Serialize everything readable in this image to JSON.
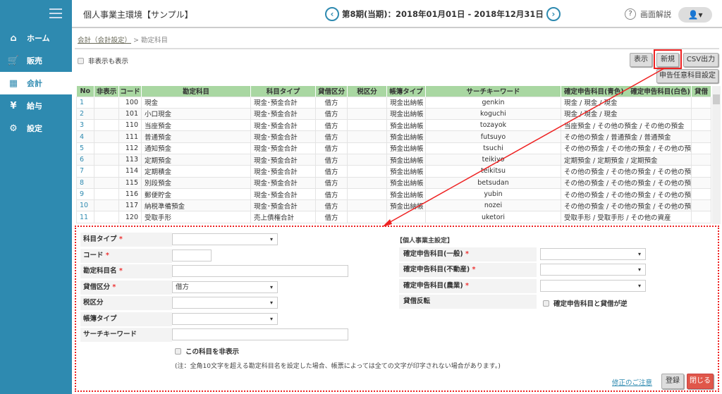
{
  "sidebar": {
    "items": [
      {
        "label": "ホーム",
        "icon": "home-icon"
      },
      {
        "label": "販売",
        "icon": "cart-icon"
      },
      {
        "label": "会計",
        "icon": "calculator-icon",
        "active": true
      },
      {
        "label": "給与",
        "icon": "money-bag-icon"
      },
      {
        "label": "設定",
        "icon": "gear-icon"
      }
    ]
  },
  "header": {
    "title": "個人事業主環境【サンプル】",
    "period": "第8期(当期)：2018年01月01日 - 2018年12月31日",
    "prev": "‹",
    "next": "›",
    "help": "画面解説",
    "help_icon": "?"
  },
  "breadcrumb": {
    "parent": "会計（会計設定）",
    "sep": ">",
    "current": "勘定科目"
  },
  "toolbar": {
    "show_hidden": "非表示も表示",
    "display": "表示",
    "new": "新規",
    "csv": "CSV出力",
    "custom": "申告任意科目設定"
  },
  "table": {
    "headers": [
      "No",
      "非表示",
      "コード",
      "勘定科目",
      "科目タイプ",
      "貸借区分",
      "税区分",
      "帳簿タイプ",
      "サーチキーワード",
      "確定申告科目(青色)",
      "確定申告科目(白色)",
      "貸借"
    ],
    "rows": [
      [
        "1",
        "",
        "100",
        "現金",
        "現金･預金合計",
        "借方",
        "",
        "現金出納帳",
        "genkin",
        "現金 / 現金 / 現金",
        ""
      ],
      [
        "2",
        "",
        "101",
        "小口現金",
        "現金･預金合計",
        "借方",
        "",
        "現金出納帳",
        "koguchi",
        "現金 / 現金 / 現金",
        ""
      ],
      [
        "3",
        "",
        "110",
        "当座預金",
        "現金･預金合計",
        "借方",
        "",
        "預金出納帳",
        "tozayok",
        "当座預金 / その他の預金 / その他の預金",
        ""
      ],
      [
        "4",
        "",
        "111",
        "普通預金",
        "現金･預金合計",
        "借方",
        "",
        "預金出納帳",
        "futsuyo",
        "その他の預金 / 普通預金 / 普通預金",
        ""
      ],
      [
        "5",
        "",
        "112",
        "通知預金",
        "現金･預金合計",
        "借方",
        "",
        "預金出納帳",
        "tsuchi",
        "その他の預金 / その他の預金 / その他の預金",
        ""
      ],
      [
        "6",
        "",
        "113",
        "定期預金",
        "現金･預金合計",
        "借方",
        "",
        "預金出納帳",
        "teikiyo",
        "定期預金 / 定期預金 / 定期預金",
        ""
      ],
      [
        "7",
        "",
        "114",
        "定期積金",
        "現金･預金合計",
        "借方",
        "",
        "預金出納帳",
        "teikitsu",
        "その他の預金 / その他の預金 / その他の預金",
        ""
      ],
      [
        "8",
        "",
        "115",
        "別段預金",
        "現金･預金合計",
        "借方",
        "",
        "預金出納帳",
        "betsudan",
        "その他の預金 / その他の預金 / その他の預金",
        ""
      ],
      [
        "9",
        "",
        "116",
        "郵便貯金",
        "現金･預金合計",
        "借方",
        "",
        "預金出納帳",
        "yubin",
        "その他の預金 / その他の預金 / その他の預金",
        ""
      ],
      [
        "10",
        "",
        "117",
        "納税準備預金",
        "現金･預金合計",
        "借方",
        "",
        "預金出納帳",
        "nozei",
        "その他の預金 / その他の預金 / その他の預金",
        ""
      ],
      [
        "11",
        "",
        "120",
        "受取手形",
        "売上債権合計",
        "借方",
        "",
        "",
        "uketori",
        "受取手形 / 受取手形 / その他の資産",
        ""
      ]
    ]
  },
  "form": {
    "type_label": "科目タイプ",
    "code_label": "コード",
    "name_label": "勘定科目名",
    "dc_label": "貸借区分",
    "dc_value": "借方",
    "tax_label": "税区分",
    "book_label": "帳簿タイプ",
    "keyword_label": "サーチキーワード",
    "hide_label": "この科目を非表示",
    "required": "*",
    "note": "(注：全角10文字を超える勘定科目名を設定した場合、帳票によっては全ての文字が印字されない場合があります。)",
    "sole_title": "【個人事業主設定】",
    "general_label": "確定申告科目(一般)",
    "realestate_label": "確定申告科目(不動産)",
    "farm_label": "確定申告科目(農業)",
    "reverse_label": "貸借反転",
    "reverse_check": "確定申告科目と貸借が逆",
    "caution_link": "修正のご注意",
    "register": "登録",
    "close": "閉じる"
  },
  "colors": {
    "sidebar": "#2e8ab0",
    "table_header": "#a9d7a2",
    "highlight": "#e22222",
    "close_button": "#e0574a"
  }
}
